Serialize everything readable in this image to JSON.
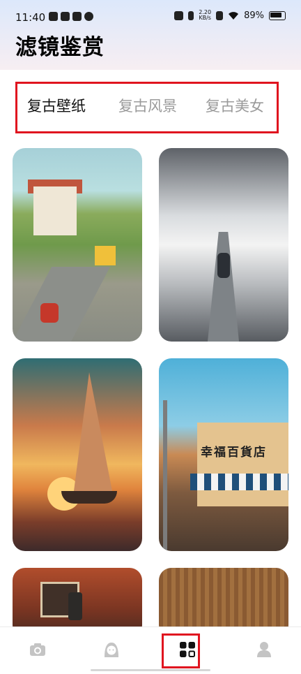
{
  "status_bar": {
    "time": "11:40",
    "net_speed_value": "2.20",
    "net_speed_unit": "KB/s",
    "battery": "89%"
  },
  "header": {
    "title": "滤镜鉴赏"
  },
  "tabs": [
    {
      "label": "复古壁纸",
      "active": true
    },
    {
      "label": "复古风景",
      "active": false
    },
    {
      "label": "复古美女",
      "active": false
    }
  ],
  "gallery": {
    "shop_sign": "幸福百貨店"
  },
  "bottom_nav": [
    {
      "icon": "camera-icon",
      "active": false
    },
    {
      "icon": "avatar-face-icon",
      "active": false
    },
    {
      "icon": "grid-icon",
      "active": true
    },
    {
      "icon": "user-icon",
      "active": false
    }
  ],
  "colors": {
    "accent_red": "#e0141f",
    "active_text": "#111111",
    "inactive_text": "#9a9a9a",
    "inactive_icon": "#c4c4c4"
  }
}
